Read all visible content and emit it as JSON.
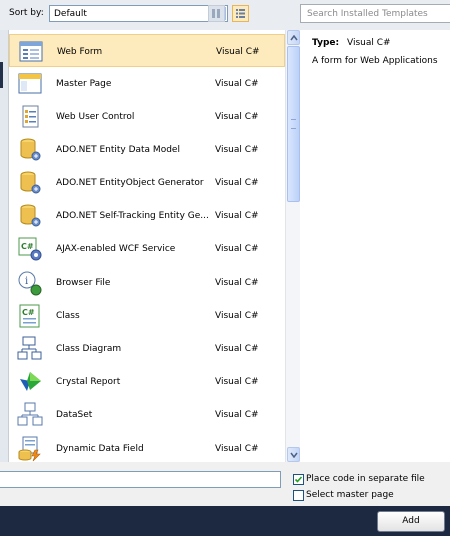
{
  "sort": {
    "label": "Sort by:",
    "value": "Default"
  },
  "search": {
    "placeholder": "Search Installed Templates"
  },
  "templates": [
    {
      "name": "Web Form",
      "lang": "Visual C#",
      "icon": "web-form-icon",
      "selected": true
    },
    {
      "name": "Master Page",
      "lang": "Visual C#",
      "icon": "master-page-icon"
    },
    {
      "name": "Web User Control",
      "lang": "Visual C#",
      "icon": "web-user-control-icon"
    },
    {
      "name": "ADO.NET Entity Data Model",
      "lang": "Visual C#",
      "icon": "entity-data-model-icon"
    },
    {
      "name": "ADO.NET EntityObject Generator",
      "lang": "Visual C#",
      "icon": "entity-generator-icon"
    },
    {
      "name": "ADO.NET Self-Tracking Entity Ge...",
      "lang": "Visual C#",
      "icon": "self-tracking-entity-icon"
    },
    {
      "name": "AJAX-enabled WCF Service",
      "lang": "Visual C#",
      "icon": "wcf-service-icon"
    },
    {
      "name": "Browser File",
      "lang": "Visual C#",
      "icon": "browser-file-icon"
    },
    {
      "name": "Class",
      "lang": "Visual C#",
      "icon": "class-icon"
    },
    {
      "name": "Class Diagram",
      "lang": "Visual C#",
      "icon": "class-diagram-icon"
    },
    {
      "name": "Crystal Report",
      "lang": "Visual C#",
      "icon": "crystal-report-icon"
    },
    {
      "name": "DataSet",
      "lang": "Visual C#",
      "icon": "dataset-icon"
    },
    {
      "name": "Dynamic Data Field",
      "lang": "Visual C#",
      "icon": "dynamic-data-field-icon"
    }
  ],
  "details": {
    "type_label": "Type:",
    "type_value": "Visual C#",
    "description": "A form for Web Applications"
  },
  "options": {
    "place_code": {
      "label": "Place code in separate file",
      "checked": true
    },
    "master_page": {
      "label": "Select master page",
      "checked": false
    }
  },
  "name_field": {
    "value": ""
  },
  "buttons": {
    "add": "Add"
  }
}
